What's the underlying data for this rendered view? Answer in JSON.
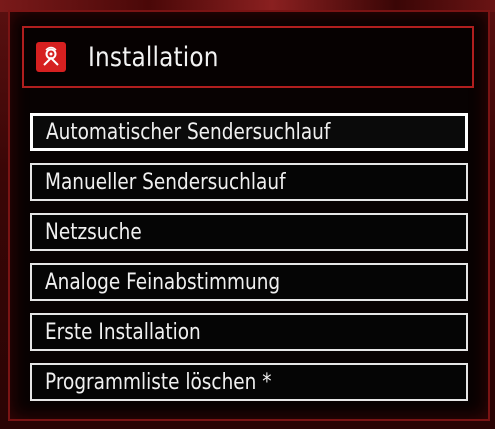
{
  "header": {
    "title": "Installation",
    "icon": "installation-satellite-icon",
    "icon_color": "#d62020"
  },
  "menu": {
    "items": [
      {
        "label": "Automatischer Sendersuchlauf",
        "selected": true
      },
      {
        "label": "Manueller Sendersuchlauf",
        "selected": false
      },
      {
        "label": "Netzsuche",
        "selected": false
      },
      {
        "label": "Analoge Feinabstimmung",
        "selected": false
      },
      {
        "label": "Erste Installation",
        "selected": false
      },
      {
        "label": "Programmliste löschen *",
        "selected": false
      }
    ]
  },
  "colors": {
    "accent": "#b01e1e",
    "background": "#080202",
    "text": "#f0f0f0"
  }
}
